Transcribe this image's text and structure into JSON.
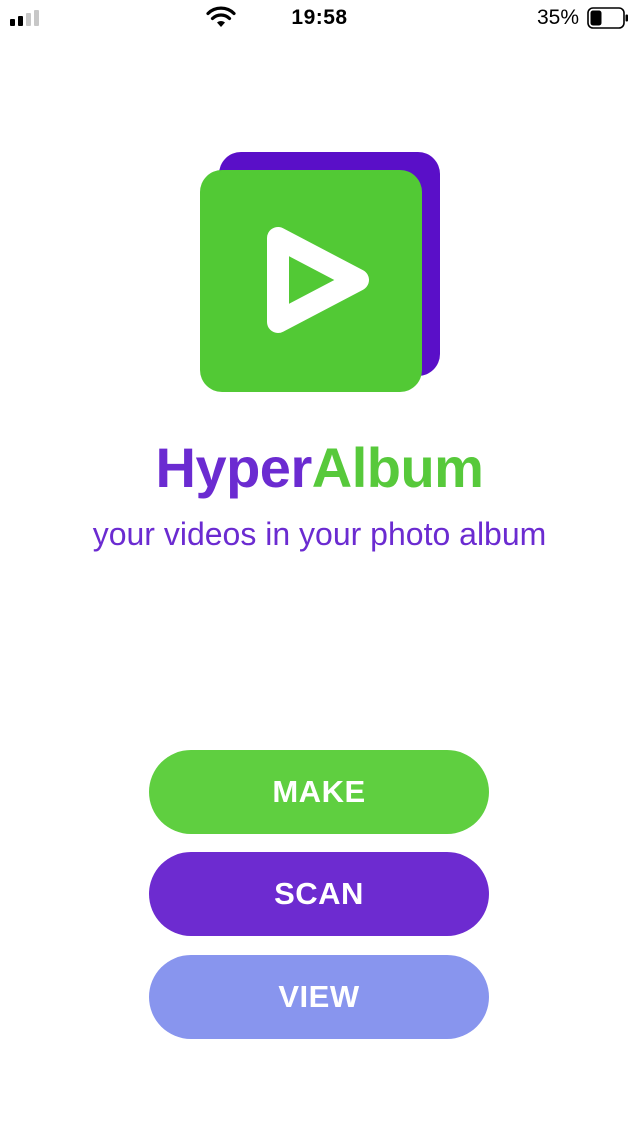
{
  "status_bar": {
    "time": "19:58",
    "battery_percent": "35%",
    "battery_level": 0.35,
    "signal_bars_active": 2,
    "icons": [
      "signal-icon",
      "wifi-icon",
      "battery-icon"
    ]
  },
  "app": {
    "title_part1": "Hyper",
    "title_part2": "Album",
    "tagline": "your videos in your photo album"
  },
  "buttons": {
    "make": "MAKE",
    "scan": "SCAN",
    "view": "VIEW"
  },
  "colors": {
    "green": "#57c93b",
    "purple": "#6b2bd1",
    "deep_purple": "#5a0fc8",
    "lavender": "#8895ee"
  }
}
